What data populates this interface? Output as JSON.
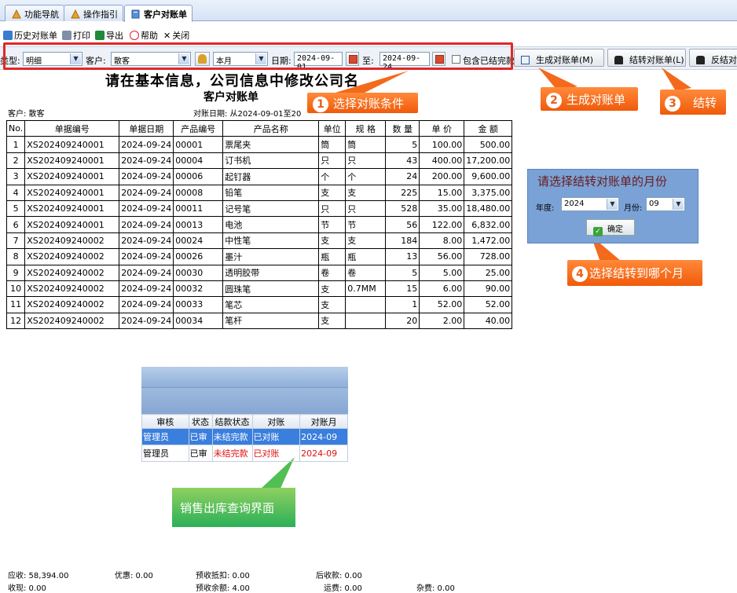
{
  "tabs": [
    {
      "label": "功能导航",
      "icon": "nav-icon"
    },
    {
      "label": "操作指引",
      "icon": "guide-icon"
    },
    {
      "label": "客户对账单",
      "icon": "doc-icon"
    }
  ],
  "toolbar": {
    "history": "历史对账单",
    "print": "打印",
    "export": "导出",
    "help": "帮助",
    "close": "关闭"
  },
  "filters": {
    "type_label": "类型:",
    "type_value": "明细",
    "customer_label": "客户:",
    "customer_value": "散客",
    "period_value": "本月",
    "date_label": "日期:",
    "date_from": "2024-09-01",
    "to_label": "至:",
    "date_to": "2024-09-24",
    "include_settled": "包含已结完款"
  },
  "actions": {
    "generate": "生成对账单(M)",
    "carry_forward": "结转对账单(L)",
    "reverse": "反结对"
  },
  "report": {
    "company": "请在基本信息，公司信息中修改公司名",
    "title": "客户对账单",
    "customer": "客户: 散客",
    "period": "对账日期:  从2024-09-01至20",
    "columns": [
      "No.",
      "单据编号",
      "单据日期",
      "产品编号",
      "产品名称",
      "单位",
      "规 格",
      "数 量",
      "单 价",
      "金 额"
    ],
    "rows": [
      [
        "1",
        "XS202409240001",
        "2024-09-24",
        "00001",
        "票尾夹",
        "筒",
        "筒",
        "5",
        "100.00",
        "500.00"
      ],
      [
        "2",
        "XS202409240001",
        "2024-09-24",
        "00004",
        "订书机",
        "只",
        "只",
        "43",
        "400.00",
        "17,200.00"
      ],
      [
        "3",
        "XS202409240001",
        "2024-09-24",
        "00006",
        "起钉器",
        "个",
        "个",
        "24",
        "200.00",
        "9,600.00"
      ],
      [
        "4",
        "XS202409240001",
        "2024-09-24",
        "00008",
        "铅笔",
        "支",
        "支",
        "225",
        "15.00",
        "3,375.00"
      ],
      [
        "5",
        "XS202409240001",
        "2024-09-24",
        "00011",
        "记号笔",
        "只",
        "只",
        "528",
        "35.00",
        "18,480.00"
      ],
      [
        "6",
        "XS202409240001",
        "2024-09-24",
        "00013",
        "电池",
        "节",
        "节",
        "56",
        "122.00",
        "6,832.00"
      ],
      [
        "7",
        "XS202409240002",
        "2024-09-24",
        "00024",
        "中性笔",
        "支",
        "支",
        "184",
        "8.00",
        "1,472.00"
      ],
      [
        "8",
        "XS202409240002",
        "2024-09-24",
        "00026",
        "墨汁",
        "瓶",
        "瓶",
        "13",
        "56.00",
        "728.00"
      ],
      [
        "9",
        "XS202409240002",
        "2024-09-24",
        "00030",
        "透明胶带",
        "卷",
        "卷",
        "5",
        "5.00",
        "25.00"
      ],
      [
        "10",
        "XS202409240002",
        "2024-09-24",
        "00032",
        "圆珠笔",
        "支",
        "0.7MM",
        "15",
        "6.00",
        "90.00"
      ],
      [
        "11",
        "XS202409240002",
        "2024-09-24",
        "00033",
        "笔芯",
        "支",
        "",
        "1",
        "52.00",
        "52.00"
      ],
      [
        "12",
        "XS202409240002",
        "2024-09-24",
        "00034",
        "笔杆",
        "支",
        "",
        "20",
        "2.00",
        "40.00"
      ]
    ]
  },
  "callouts": {
    "c1": {
      "num": "1",
      "text": "选择对账条件"
    },
    "c2": {
      "num": "2",
      "text": "生成对账单"
    },
    "c3": {
      "num": "3",
      "text": "结转"
    },
    "c4": {
      "num": "4",
      "text": "选择结转到哪个月"
    },
    "green": "销售出库查询界面"
  },
  "month_panel": {
    "title": "请选择结转对账单的月份",
    "year_label": "年度:",
    "year_value": "2024",
    "month_label": "月份:",
    "month_value": "09",
    "ok": "确定"
  },
  "grid": {
    "columns": [
      "审核",
      "状态",
      "结款状态",
      "对账",
      "对账月"
    ],
    "rows": [
      [
        "管理员",
        "已审",
        "未结完款",
        "已对账",
        "2024-09"
      ],
      [
        "管理员",
        "已审",
        "未结完款",
        "已对账",
        "2024-09"
      ]
    ]
  },
  "footer": {
    "receivable": "应收:  58,394.00",
    "discount": "优惠:  0.00",
    "prepay_deduct": "预收抵扣:  0.00",
    "post_receipt": "后收款:  0.00",
    "received": "收现:  0.00",
    "prepay_balance": "预收余额:  4.00",
    "freight": "运费:  0.00",
    "misc": "杂费:  0.00"
  },
  "colors": {
    "highlight_box": "#e02828",
    "callout_orange": "#f05a0a",
    "callout_green": "#2bb058",
    "selected_row": "#3a7ede"
  }
}
